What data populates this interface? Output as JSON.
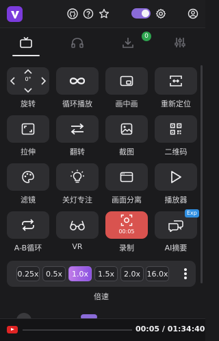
{
  "topbar": {
    "logo_icon": "v-logo-icon",
    "icons": [
      "github-icon",
      "help-icon",
      "star-icon",
      "theme-toggle",
      "gear-icon",
      "user-icon"
    ],
    "theme_toggle_on": true
  },
  "tabs": {
    "items": [
      "tv-icon",
      "headphones-icon",
      "download-icon",
      "sliders-icon"
    ],
    "active": 0,
    "download_badge": "0"
  },
  "tools": [
    {
      "label": "旋转",
      "icon": "rotate-icon",
      "value": "0°"
    },
    {
      "label": "循环播放",
      "icon": "infinity-icon"
    },
    {
      "label": "画中画",
      "icon": "pip-icon"
    },
    {
      "label": "重新定位",
      "icon": "reposition-icon"
    },
    {
      "label": "拉伸",
      "icon": "stretch-icon"
    },
    {
      "label": "翻转",
      "icon": "flip-icon"
    },
    {
      "label": "截图",
      "icon": "screenshot-icon"
    },
    {
      "label": "二维码",
      "icon": "qrcode-icon"
    },
    {
      "label": "滤镜",
      "icon": "palette-icon"
    },
    {
      "label": "关灯专注",
      "icon": "lightbulb-icon"
    },
    {
      "label": "画面分离",
      "icon": "window-icon"
    },
    {
      "label": "播放器",
      "icon": "play-icon"
    },
    {
      "label": "A-B循环",
      "icon": "ab-loop-icon"
    },
    {
      "label": "VR",
      "icon": "vr-glasses-icon"
    },
    {
      "label": "录制",
      "icon": "record-icon",
      "value": "00:05",
      "color": "#d9534f"
    },
    {
      "label": "AI摘要",
      "icon": "ai-chat-icon",
      "badge": "Exp"
    }
  ],
  "speed": {
    "options": [
      "0.25x",
      "0.5x",
      "1.0x",
      "1.5x",
      "2.0x",
      "16.0x"
    ],
    "active": "1.0x",
    "label": "倍速",
    "more_icon": "more-vertical-icon"
  },
  "player": {
    "icon": "youtube-icon",
    "time": "00:05 / 01:34:40",
    "progress": 0.001
  },
  "colors": {
    "accent": "#8a52e0",
    "record": "#d9534f",
    "badge_green": "#2ea44f",
    "exp_blue": "#2f8ee0"
  }
}
